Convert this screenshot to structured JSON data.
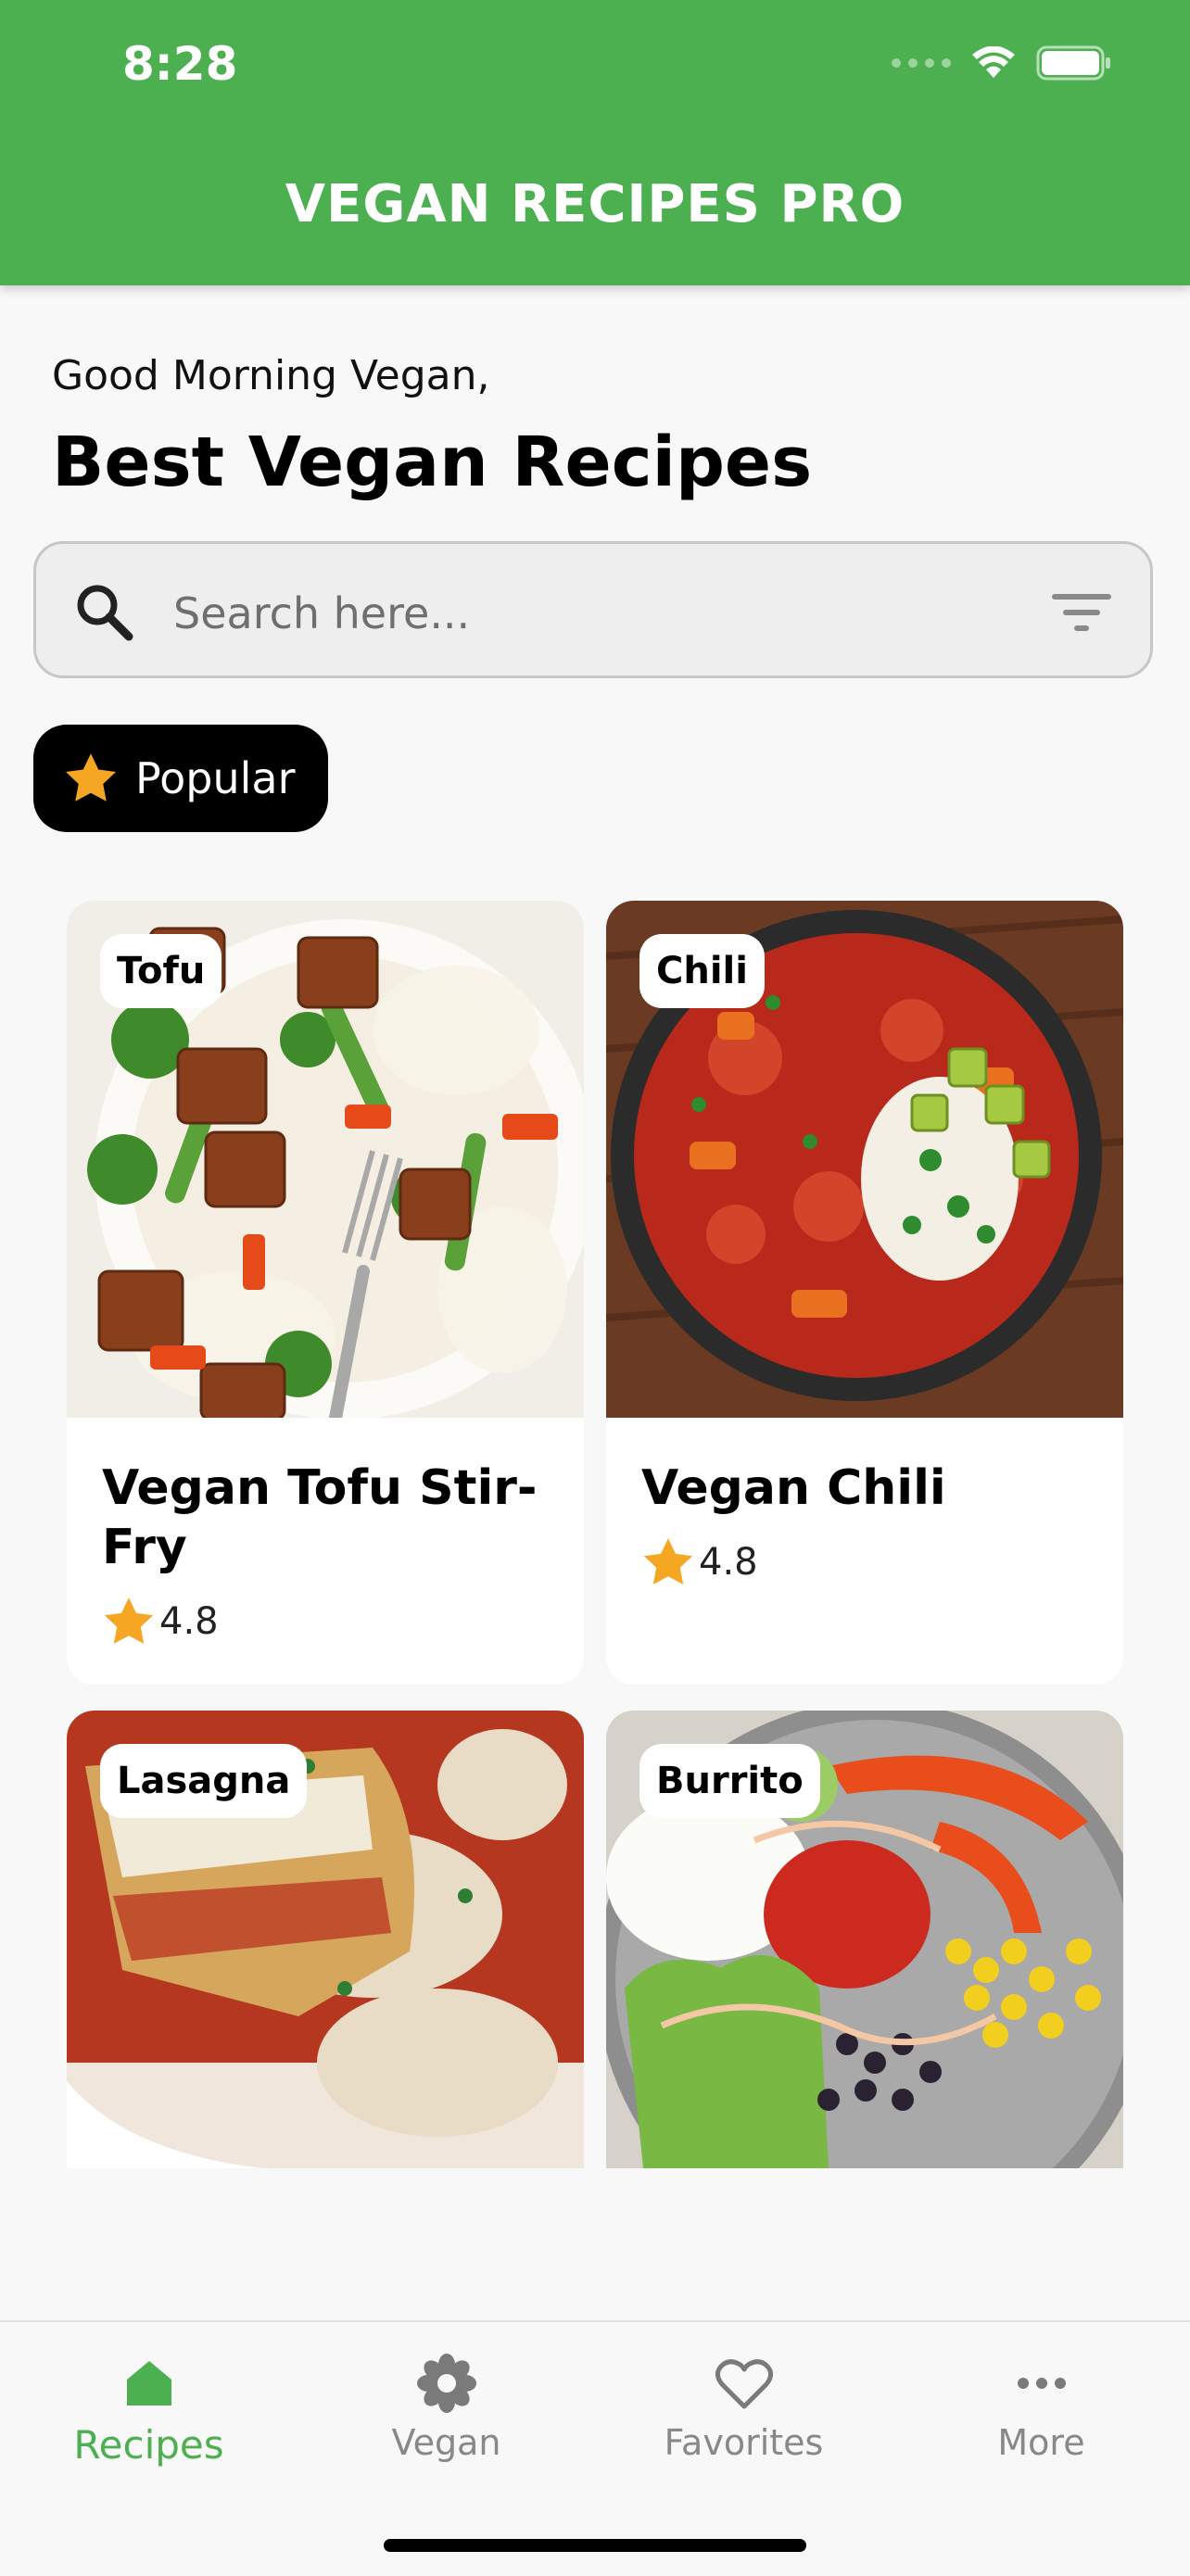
{
  "status_bar": {
    "time": "8:28"
  },
  "app": {
    "title": "VEGAN RECIPES PRO"
  },
  "greeting": "Good Morning Vegan,",
  "page_title": "Best Vegan Recipes",
  "search": {
    "placeholder": "Search here...",
    "value": ""
  },
  "filter_chip": {
    "label": "Popular",
    "icon": "star-icon"
  },
  "recipes": [
    {
      "tag": "Tofu",
      "name": "Vegan Tofu Stir-Fry",
      "rating": "4.8"
    },
    {
      "tag": "Chili",
      "name": "Vegan Chili",
      "rating": "4.8"
    },
    {
      "tag": "Lasagna"
    },
    {
      "tag": "Burrito"
    }
  ],
  "bottom_nav": {
    "items": [
      {
        "label": "Recipes",
        "icon": "home-icon",
        "active": true
      },
      {
        "label": "Vegan",
        "icon": "flower-icon",
        "active": false
      },
      {
        "label": "Favorites",
        "icon": "heart-icon",
        "active": false
      },
      {
        "label": "More",
        "icon": "more-icon",
        "active": false
      }
    ]
  },
  "colors": {
    "primary": "#4caf50",
    "star": "#f5a623",
    "chip_bg": "#000000",
    "nav_inactive": "#888888"
  }
}
